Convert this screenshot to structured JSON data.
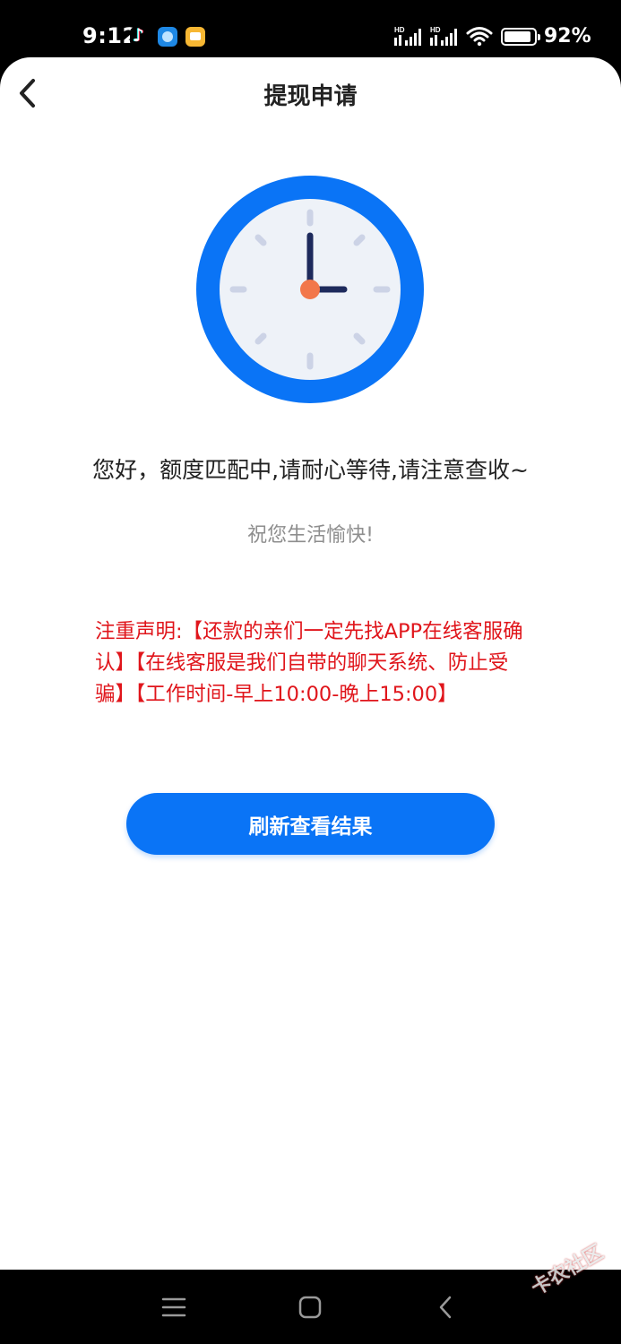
{
  "status_bar": {
    "time": "9:12",
    "battery_percent": "92%",
    "battery_level": 0.92,
    "icons": [
      "tiktok-icon",
      "app-blue-icon",
      "app-yellow-icon",
      "signal-icon",
      "signal-icon",
      "wifi-icon",
      "battery-icon"
    ]
  },
  "header": {
    "title": "提现申请",
    "back_icon": "chevron-left-icon"
  },
  "main": {
    "illustration": "clock-icon",
    "message": "您好，额度匹配中,请耐心等待,请注意查收~",
    "wish": "祝您生活愉快!",
    "notice": "注重声明:【还款的亲们一定先找APP在线客服确认】【在线客服是我们自带的聊天系统、防止受骗】【工作时间-早上10:00-晚上15:00】",
    "refresh_button": "刷新查看结果"
  },
  "nav_bar": {
    "icons": [
      "menu-icon",
      "home-icon",
      "back-icon"
    ]
  },
  "watermark": "卡农社区",
  "colors": {
    "accent": "#0a74f6",
    "notice": "#e0151b",
    "clock_ring": "#0a74f6",
    "clock_face": "#eef2f8",
    "clock_hand": "#1d2a5c",
    "clock_center": "#f2774b"
  }
}
